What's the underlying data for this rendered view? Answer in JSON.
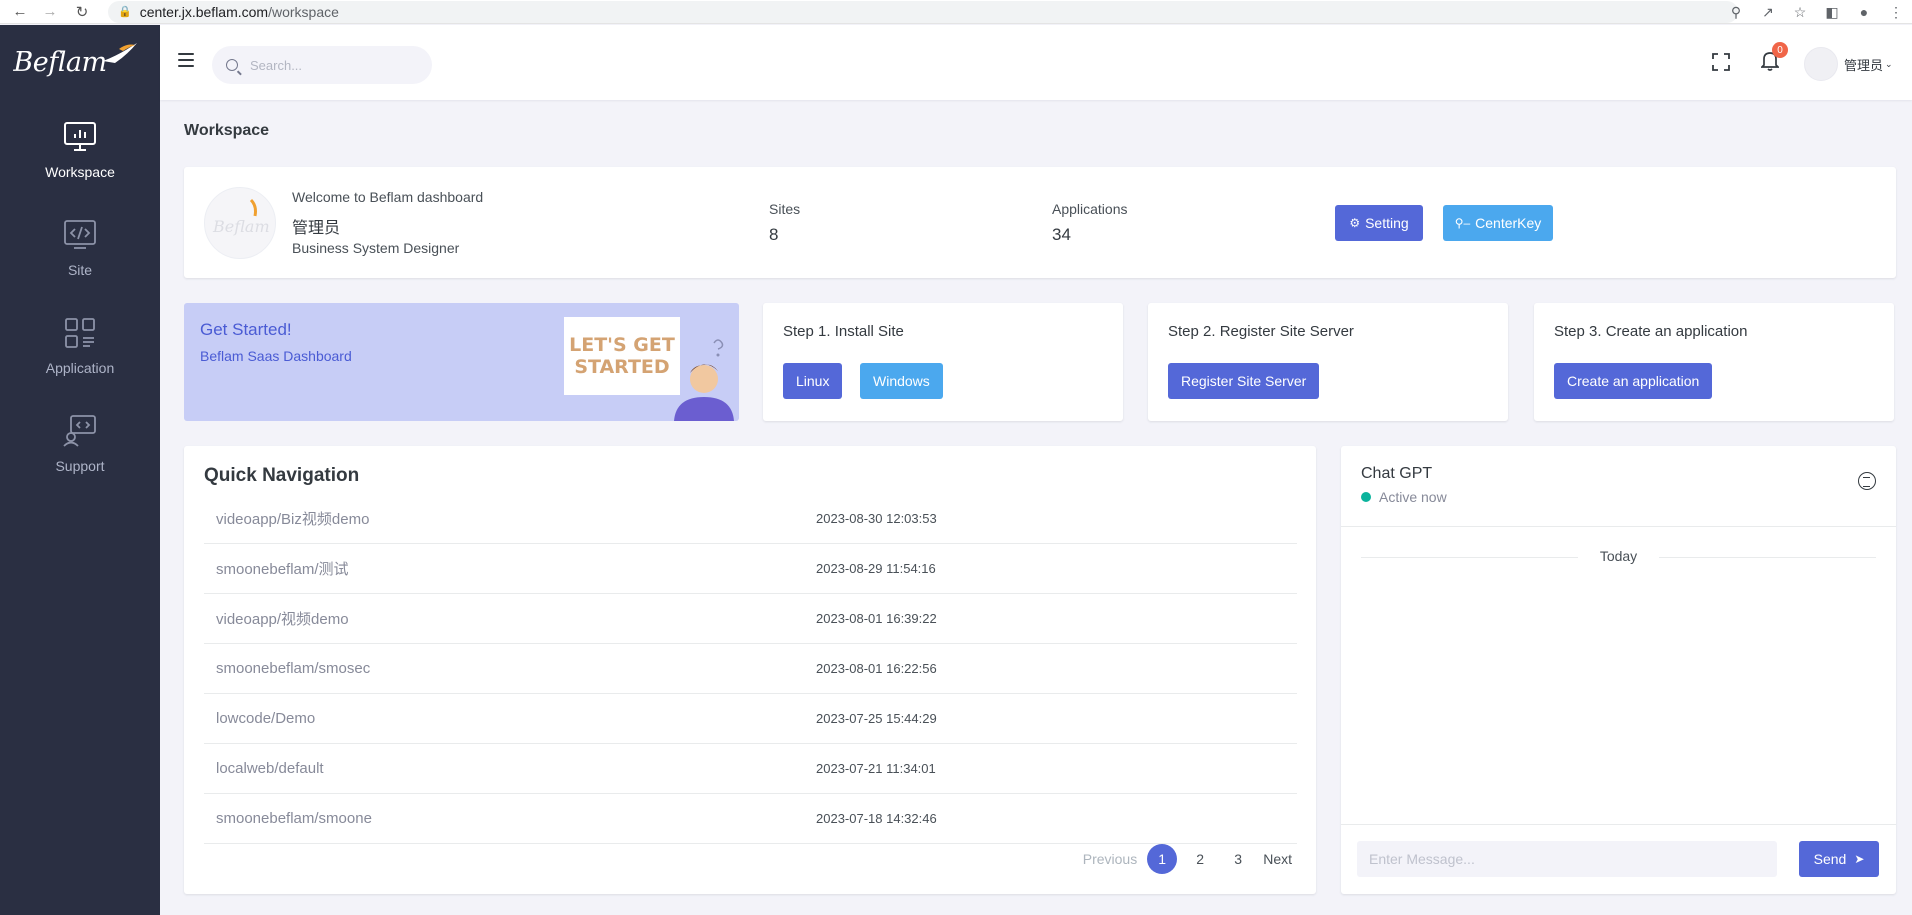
{
  "browser": {
    "url_host": "center.jx.beflam.com",
    "url_path": "/workspace"
  },
  "sidebar": {
    "logo": "Beflam",
    "items": [
      {
        "label": "Workspace",
        "icon": "monitor-chart-icon"
      },
      {
        "label": "Site",
        "icon": "code-window-icon"
      },
      {
        "label": "Application",
        "icon": "apps-grid-icon"
      },
      {
        "label": "Support",
        "icon": "support-screen-icon"
      }
    ]
  },
  "topbar": {
    "search_placeholder": "Search...",
    "notification_count": "0",
    "user_name": "管理员"
  },
  "page": {
    "title": "Workspace"
  },
  "profile": {
    "welcome": "Welcome to Beflam dashboard",
    "name": "管理员",
    "role": "Business System Designer",
    "sites_label": "Sites",
    "sites_value": "8",
    "apps_label": "Applications",
    "apps_value": "34",
    "setting_label": "Setting",
    "centerkey_label": "CenterKey"
  },
  "getting_started": {
    "title": "Get Started!",
    "subtitle": "Beflam Saas Dashboard",
    "illustration_text_1": "LET'S GET",
    "illustration_text_2": "STARTED"
  },
  "steps": [
    {
      "title": "Step 1. Install Site",
      "buttons": [
        "Linux",
        "Windows"
      ]
    },
    {
      "title": "Step 2. Register Site Server",
      "buttons": [
        "Register Site Server"
      ]
    },
    {
      "title": "Step 3. Create an application",
      "buttons": [
        "Create an application"
      ]
    }
  ],
  "quick_nav": {
    "title": "Quick Navigation",
    "rows": [
      {
        "name": "videoapp/Biz视频demo",
        "time": "2023-08-30 12:03:53"
      },
      {
        "name": "smoonebeflam/测试",
        "time": "2023-08-29 11:54:16"
      },
      {
        "name": "videoapp/视频demo",
        "time": "2023-08-01 16:39:22"
      },
      {
        "name": "smoonebeflam/smosec",
        "time": "2023-08-01 16:22:56"
      },
      {
        "name": "lowcode/Demo",
        "time": "2023-07-25 15:44:29"
      },
      {
        "name": "localweb/default",
        "time": "2023-07-21 11:34:01"
      },
      {
        "name": "smoonebeflam/smoone",
        "time": "2023-07-18 14:32:46"
      }
    ],
    "pager": {
      "previous": "Previous",
      "pages": [
        "1",
        "2",
        "3"
      ],
      "current": "1",
      "next": "Next"
    }
  },
  "chat": {
    "title": "Chat GPT",
    "status": "Active now",
    "day_label": "Today",
    "input_placeholder": "Enter Message...",
    "send_label": "Send"
  },
  "colors": {
    "sidebar_bg": "#2a2f42",
    "primary": "#5468d8",
    "info": "#4ba8ee",
    "badge": "#f06548",
    "online": "#0ab39c"
  }
}
